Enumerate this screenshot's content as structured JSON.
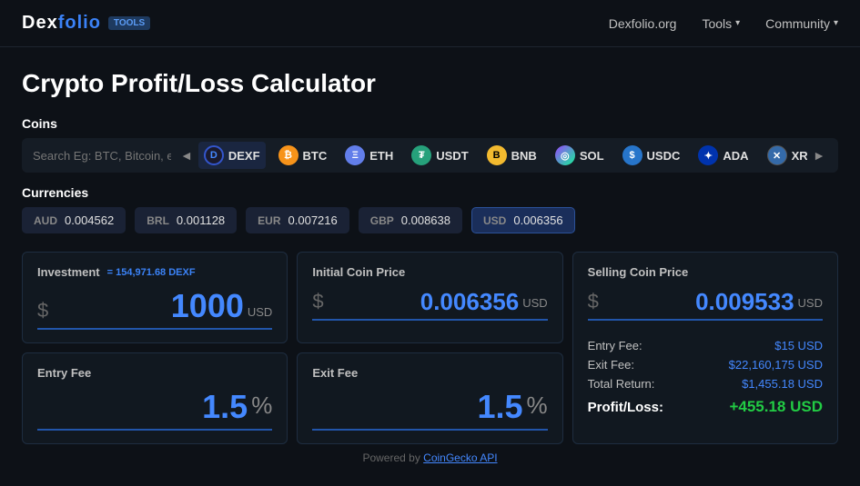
{
  "navbar": {
    "logo": "Dexfolio",
    "logo_accent": "Dex",
    "badge": "Tools",
    "links": [
      {
        "id": "dexfolio-org",
        "label": "Dexfolio.org",
        "has_arrow": false
      },
      {
        "id": "tools",
        "label": "Tools",
        "has_arrow": true
      },
      {
        "id": "community",
        "label": "Community",
        "has_arrow": true
      }
    ]
  },
  "page": {
    "title": "Crypto Profit/Loss Calculator"
  },
  "coins": {
    "section_label": "Coins",
    "search_placeholder": "Search Eg: BTC, Bitcoin, etc.",
    "items": [
      {
        "id": "dexf",
        "symbol": "DEXF",
        "icon_char": "D",
        "icon_class": "icon-dexf",
        "active": true
      },
      {
        "id": "btc",
        "symbol": "BTC",
        "icon_char": "₿",
        "icon_class": "icon-btc"
      },
      {
        "id": "eth",
        "symbol": "ETH",
        "icon_char": "Ξ",
        "icon_class": "icon-eth"
      },
      {
        "id": "usdt",
        "symbol": "USDT",
        "icon_char": "₮",
        "icon_class": "icon-usdt"
      },
      {
        "id": "bnb",
        "symbol": "BNB",
        "icon_char": "B",
        "icon_class": "icon-bnb"
      },
      {
        "id": "sol",
        "symbol": "SOL",
        "icon_char": "◎",
        "icon_class": "icon-sol"
      },
      {
        "id": "usdc",
        "symbol": "USDC",
        "icon_char": "$",
        "icon_class": "icon-usdc"
      },
      {
        "id": "ada",
        "symbol": "ADA",
        "icon_char": "✦",
        "icon_class": "icon-ada"
      },
      {
        "id": "xrp",
        "symbol": "XRP",
        "icon_char": "✕",
        "icon_class": "icon-xrp"
      }
    ]
  },
  "currencies": {
    "section_label": "Currencies",
    "items": [
      {
        "id": "aud",
        "code": "AUD",
        "value": "0.004562",
        "active": false
      },
      {
        "id": "brl",
        "code": "BRL",
        "value": "0.001128",
        "active": false
      },
      {
        "id": "eur",
        "code": "EUR",
        "value": "0.007216",
        "active": false
      },
      {
        "id": "gbp",
        "code": "GBP",
        "value": "0.008638",
        "active": false
      },
      {
        "id": "usd",
        "code": "USD",
        "value": "0.006356",
        "active": true
      }
    ]
  },
  "investment": {
    "label": "Investment",
    "equiv": "= 154,971.68 DEXF",
    "currency_sym": "$",
    "value": "1000",
    "unit": "USD"
  },
  "initial_price": {
    "label": "Initial Coin Price",
    "currency_sym": "$",
    "value": "0.006356",
    "unit": "USD"
  },
  "selling_price": {
    "label": "Selling Coin Price",
    "currency_sym": "$",
    "value": "0.009533",
    "unit": "USD"
  },
  "entry_fee": {
    "label": "Entry Fee",
    "value": "1.5",
    "unit": "%"
  },
  "exit_fee": {
    "label": "Exit Fee",
    "value": "1.5",
    "unit": "%"
  },
  "results": {
    "entry_fee_label": "Entry Fee:",
    "entry_fee_value": "$15 USD",
    "exit_fee_label": "Exit Fee:",
    "exit_fee_value": "$22,160,175 USD",
    "total_return_label": "Total Return:",
    "total_return_value": "$1,455.18 USD",
    "profit_loss_label": "Profit/Loss:",
    "profit_loss_value": "+455.18 USD"
  },
  "footer": {
    "text": "Powered by ",
    "link": "CoinGecko API"
  }
}
